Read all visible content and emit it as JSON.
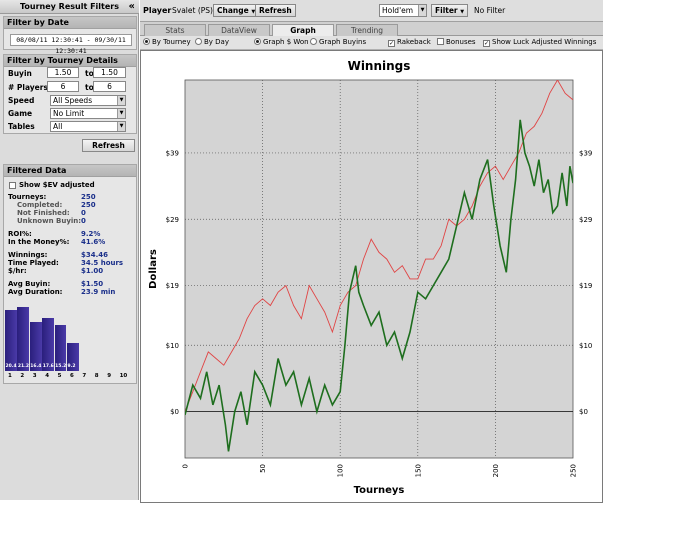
{
  "left_panel": {
    "title": "Tourney Result Filters",
    "collapse_glyph": "«",
    "filter_by_date": {
      "title": "Filter by Date",
      "range": "08/08/11 12:30:41 - 09/30/11 12:30:41"
    },
    "filter_by_details": {
      "title": "Filter by Tourney Details",
      "buyin_label": "Buyin",
      "buyin_from": "1.50",
      "buyin_to": "1.50",
      "players_label": "# Players",
      "players_from": "6",
      "players_to": "6",
      "to_label": "to",
      "speed_label": "Speed",
      "speed_value": "All Speeds",
      "game_label": "Game",
      "game_value": "No Limit",
      "tables_label": "Tables",
      "tables_value": "All"
    },
    "refresh_label": "Refresh",
    "filtered_data": {
      "title": "Filtered Data",
      "show_sev_label": "Show $EV adjusted",
      "stats": [
        {
          "label": "Tourneys:",
          "value": "250",
          "indent": false
        },
        {
          "label": "Completed:",
          "value": "250",
          "indent": true
        },
        {
          "label": "Not Finished:",
          "value": "0",
          "indent": true
        },
        {
          "label": "Unknown Buyin:",
          "value": "0",
          "indent": true
        },
        {
          "label": "ROI%:",
          "value": "9.2%",
          "indent": false
        },
        {
          "label": "In the Money%:",
          "value": "41.6%",
          "indent": false
        },
        {
          "label": "Winnings:",
          "value": "$34.46",
          "indent": false
        },
        {
          "label": "Time Played:",
          "value": "34.5 hours",
          "indent": false
        },
        {
          "label": "$/hr:",
          "value": "$1.00",
          "indent": false
        },
        {
          "label": "Avg Buyin:",
          "value": "$1.50",
          "indent": false
        },
        {
          "label": "Avg Duration:",
          "value": "23.9 min",
          "indent": false
        }
      ],
      "histogram": {
        "positions": [
          "1",
          "2",
          "3",
          "4",
          "5",
          "6",
          "7",
          "8",
          "9",
          "10"
        ],
        "values": [
          20.4,
          21.2,
          16.4,
          17.6,
          15.2,
          9.2,
          0,
          0,
          0,
          0
        ],
        "labels": [
          "20.4",
          "21.2",
          "16.4",
          "17.6",
          "15.2",
          "9.2",
          "",
          "",
          "",
          ""
        ]
      }
    }
  },
  "toolbar": {
    "player_label": "Player",
    "player_value": "Svalet (PS)",
    "change_label": "Change",
    "refresh_label": "Refresh",
    "game_value": "Hold'em",
    "filter_label": "Filter",
    "filter_status": "No Filter"
  },
  "tabs": [
    {
      "label": "Stats",
      "active": false
    },
    {
      "label": "DataView",
      "active": false
    },
    {
      "label": "Graph",
      "active": true
    },
    {
      "label": "Trending",
      "active": false
    }
  ],
  "options": {
    "by_tourney": "By Tourney",
    "by_day": "By Day",
    "graph_won": "Graph $ Won",
    "graph_buyins": "Graph Buyins",
    "rakeback": "Rakeback",
    "bonuses": "Bonuses",
    "show_luck": "Show Luck Adjusted Winnings",
    "checkmark": "✓"
  },
  "chart_data": {
    "type": "line",
    "title": "Winnings",
    "xlabel": "Tourneys",
    "ylabel": "Dollars",
    "xlim": [
      0,
      250
    ],
    "ylim": [
      -7,
      50
    ],
    "x_ticks": [
      0,
      50,
      100,
      150,
      200,
      250
    ],
    "y_ticks": [
      0,
      10,
      19,
      29,
      39
    ],
    "y_tick_labels": [
      "$0",
      "$10",
      "$19",
      "$29",
      "$39"
    ],
    "grid": true,
    "colors": {
      "actual": "#1e6e1e",
      "luck_adjusted": "#e04545",
      "plot_bg": "#d4d4d4"
    },
    "series": [
      {
        "key": "actual",
        "x": [
          0,
          5,
          10,
          14,
          18,
          22,
          26,
          28,
          32,
          36,
          40,
          45,
          50,
          55,
          60,
          65,
          70,
          75,
          80,
          85,
          90,
          95,
          100,
          103,
          106,
          110,
          112,
          115,
          120,
          125,
          130,
          135,
          140,
          145,
          150,
          155,
          160,
          165,
          170,
          175,
          180,
          185,
          190,
          195,
          199,
          203,
          207,
          210,
          213,
          216,
          219,
          222,
          225,
          228,
          231,
          234,
          237,
          240,
          243,
          246,
          248,
          250
        ],
        "y": [
          -0.5,
          4,
          2,
          6,
          1,
          4,
          -2,
          -6,
          0,
          3,
          -2,
          6,
          4,
          1,
          8,
          4,
          6,
          1,
          5,
          0,
          4,
          1,
          3,
          10,
          18,
          22,
          18,
          16,
          13,
          15,
          10,
          12,
          8,
          12,
          18,
          17,
          19,
          21,
          23,
          28,
          33,
          29,
          35,
          38,
          31,
          25,
          21,
          29,
          35,
          44,
          39,
          37,
          34,
          38,
          33,
          35,
          30,
          31,
          36,
          31,
          37,
          34.46
        ]
      },
      {
        "key": "luck_adjusted",
        "x": [
          0,
          5,
          10,
          15,
          20,
          25,
          30,
          35,
          40,
          45,
          50,
          55,
          60,
          65,
          70,
          75,
          80,
          85,
          90,
          95,
          100,
          105,
          110,
          115,
          120,
          125,
          130,
          135,
          140,
          145,
          150,
          155,
          160,
          165,
          170,
          175,
          180,
          185,
          190,
          195,
          200,
          205,
          210,
          215,
          220,
          225,
          230,
          235,
          240,
          245,
          250
        ],
        "y": [
          0,
          3,
          6,
          9,
          8,
          7,
          9,
          11,
          14,
          16,
          17,
          16,
          18,
          19,
          16,
          14,
          19,
          17,
          15,
          12,
          16,
          18,
          19,
          23,
          26,
          24,
          23,
          21,
          22,
          20,
          20,
          23,
          23,
          25,
          29,
          28,
          29,
          31,
          34,
          36,
          37,
          35,
          37,
          39,
          42,
          43,
          45,
          48,
          50,
          48,
          47
        ]
      }
    ]
  }
}
